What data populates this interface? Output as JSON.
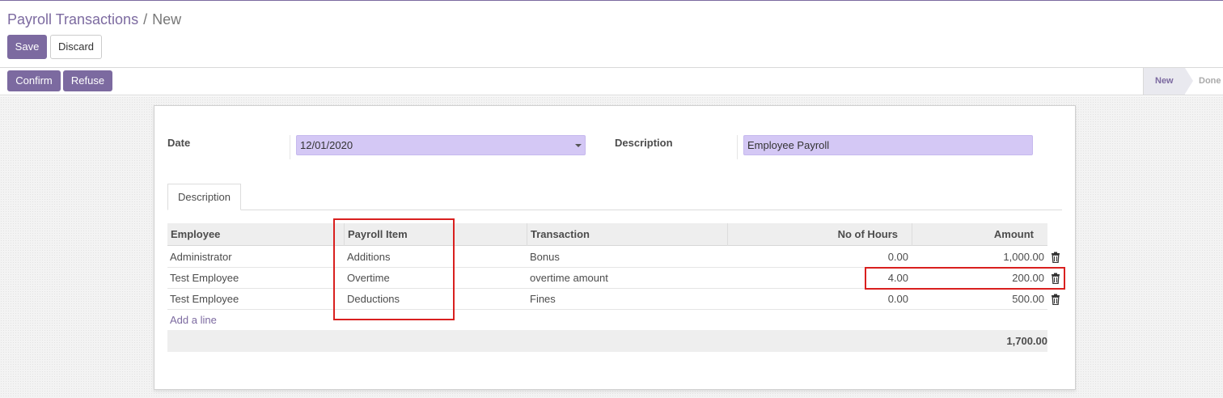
{
  "breadcrumb": {
    "parent": "Payroll Transactions",
    "separator": "/",
    "current": "New"
  },
  "buttons": {
    "save": "Save",
    "discard": "Discard",
    "confirm": "Confirm",
    "refuse": "Refuse"
  },
  "statusbar": {
    "stages": [
      "New",
      "Done"
    ],
    "active_stage": "New"
  },
  "form": {
    "date_label": "Date",
    "date_value": "12/01/2020",
    "description_label": "Description",
    "description_value": "Employee Payroll"
  },
  "tabs": [
    {
      "label": "Description",
      "active": true
    }
  ],
  "table": {
    "columns": [
      "Employee",
      "Payroll Item",
      "Transaction",
      "No of Hours",
      "Amount"
    ],
    "rows": [
      {
        "employee": "Administrator",
        "payroll_item": "Additions",
        "transaction": "Bonus",
        "hours": "0.00",
        "amount": "1,000.00"
      },
      {
        "employee": "Test Employee",
        "payroll_item": "Overtime",
        "transaction": "overtime amount",
        "hours": "4.00",
        "amount": "200.00"
      },
      {
        "employee": "Test Employee",
        "payroll_item": "Deductions",
        "transaction": "Fines",
        "hours": "0.00",
        "amount": "500.00"
      }
    ],
    "add_line": "Add a line",
    "total": "1,700.00"
  },
  "icons": {
    "row_delete": "trash-icon",
    "date_dropdown": "caret-down-icon"
  },
  "colors": {
    "brand": "#7c6aa0",
    "field_fill": "#d4c8f5",
    "annotation": "#d9201f"
  }
}
